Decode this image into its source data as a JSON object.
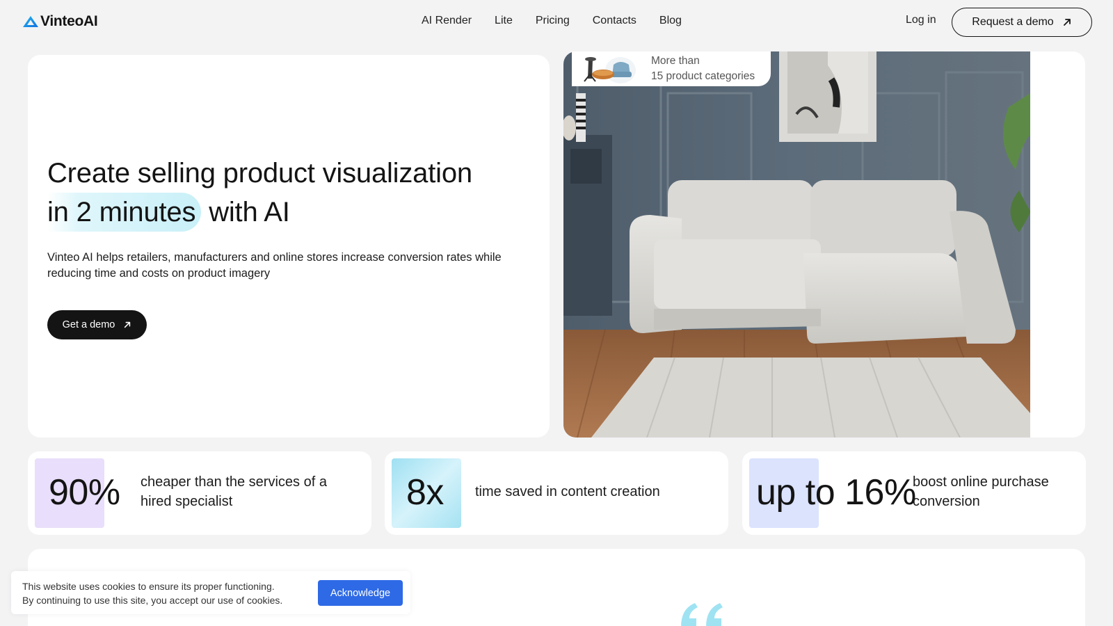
{
  "header": {
    "logo_text": "VinteoAI",
    "nav": [
      "AI Render",
      "Lite",
      "Pricing",
      "Contacts",
      "Blog"
    ],
    "login": "Log in",
    "request_demo": "Request a demo"
  },
  "hero": {
    "title_line1": "Create selling product visualization",
    "title_highlight": "in 2 minutes",
    "title_rest": "with AI",
    "subtitle": "Vinteo AI helps retailers, manufacturers and online stores increase conversion rates while reducing time and costs on product imagery",
    "cta": "Get a demo",
    "categories_line1": "More than",
    "categories_line2": "15 product categories"
  },
  "stats": [
    {
      "value": "90%",
      "description": "cheaper than the services of a hired specialist",
      "tile_color": "#e9defb"
    },
    {
      "value": "8x",
      "description": "time saved in content creation",
      "tile_color": "#bfeaf6"
    },
    {
      "value": "up to 16%",
      "description": "boost online purchase conversion",
      "tile_color": "#dbe3fd"
    }
  ],
  "cookie": {
    "line1": "This website uses cookies to ensure its proper functioning.",
    "line2": "By continuing to use this site, you accept our use of cookies.",
    "button": "Acknowledge"
  },
  "colors": {
    "accent_blue": "#2e6ae6",
    "logo_blue": "#1aa3e8",
    "highlight": "#c9f0f8"
  }
}
